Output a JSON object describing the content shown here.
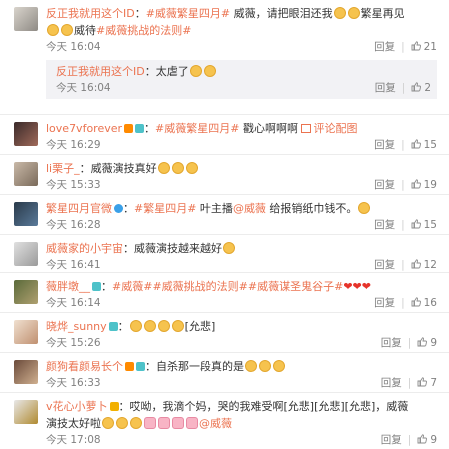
{
  "comments": [
    {
      "user": "反正我就用这个ID",
      "colon": "：",
      "topic1": "#威薇繁星四月#",
      "text1": " 威薇，请把眼泪还我",
      "text2": "繁星再见",
      "text3": "威待",
      "topic2": "#威薇挑战的法则#",
      "time": "今天 16:04",
      "reply_label": "回复",
      "like_count": "21",
      "reply": {
        "user": "反正我就用这个ID",
        "colon": "：",
        "text": "太虐了",
        "time": "今天 16:04",
        "reply_label": "回复",
        "like_count": "2"
      }
    },
    {
      "user": "love7vforever",
      "colon": "：",
      "topic": "#威薇繁星四月#",
      "text": " 戳心啊啊啊",
      "pic_link": "评论配图",
      "time": "今天 16:29",
      "reply_label": "回复",
      "like_count": "15"
    },
    {
      "user": "li栗子_",
      "colon": "：",
      "text": "威薇演技真好",
      "time": "今天 15:33",
      "reply_label": "回复",
      "like_count": "19"
    },
    {
      "user": "繁星四月官微",
      "colon": "：",
      "topic": "#繁星四月#",
      "text1": " 叶主播",
      "at": "@威薇",
      "text2": " 给报销纸巾钱不。",
      "time": "今天 16:28",
      "reply_label": "回复",
      "like_count": "15"
    },
    {
      "user": "威薇家的小宇宙",
      "colon": "：",
      "text": "威薇演技越来越好",
      "time": "今天 16:41",
      "reply_label": "回复",
      "like_count": "12"
    },
    {
      "user": "薇胖墩__",
      "colon": "：",
      "topic1": "#威薇#",
      "topic2": "#威薇挑战的法则#",
      "topic3": "#威薇谋圣鬼谷子#",
      "time": "今天 16:14",
      "reply_label": "回复",
      "like_count": "16"
    },
    {
      "user": "晓烨_sunny",
      "colon": "：",
      "text": "[允悲]",
      "time": "今天 15:26",
      "reply_label": "回复",
      "like_count": "9"
    },
    {
      "user": "颜狗看颜易长个",
      "colon": "：",
      "text": "自杀那一段真的是",
      "time": "今天 16:33",
      "reply_label": "回复",
      "like_count": "7"
    },
    {
      "user": "v花心小萝卜",
      "colon": "：",
      "text1": "哎呦，我滴个妈，哭的我难受啊[允悲][允悲][允悲]，威薇",
      "text2": "演技太好啦",
      "at": "@威薇",
      "time": "今天 17:08",
      "reply_label": "回复",
      "like_count": "9"
    }
  ],
  "colors": {
    "link": "#eb7350",
    "meta": "#808080",
    "heart": "#e6332a"
  }
}
